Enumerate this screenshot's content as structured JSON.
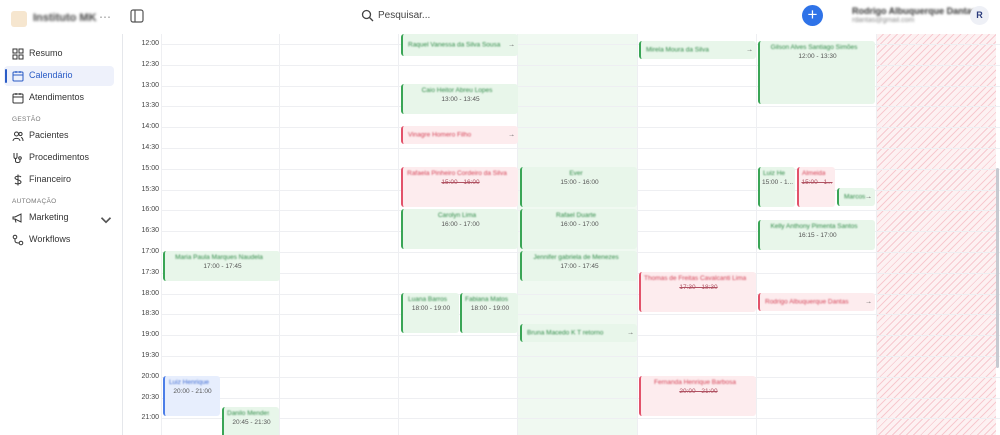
{
  "header": {
    "brand": "Instituto MK",
    "search_placeholder": "Pesquisar...",
    "add_label": "+",
    "user_name": "Rodrigo Albuquerque Dantas",
    "user_email": "rdantas@gmail.com",
    "avatar_initial": "R"
  },
  "sidebar": {
    "items": [
      {
        "label": "Resumo",
        "icon": "dashboard-icon"
      },
      {
        "label": "Calendário",
        "icon": "calendar-icon",
        "active": true
      },
      {
        "label": "Atendimentos",
        "icon": "calendar-list-icon"
      }
    ],
    "section_gestao": "GESTÃO",
    "gestao_items": [
      {
        "label": "Pacientes",
        "icon": "users-icon"
      },
      {
        "label": "Procedimentos",
        "icon": "stethoscope-icon"
      },
      {
        "label": "Financeiro",
        "icon": "dollar-icon"
      }
    ],
    "section_automacao": "AUTOMAÇÃO",
    "automacao_items": [
      {
        "label": "Marketing",
        "icon": "megaphone-icon"
      },
      {
        "label": "Workflows",
        "icon": "workflow-icon"
      }
    ]
  },
  "calendar": {
    "times": [
      "12:00",
      "12:30",
      "13:00",
      "13:30",
      "14:00",
      "14:30",
      "15:00",
      "15:30",
      "16:00",
      "16:30",
      "17:00",
      "17:30",
      "18:00",
      "18:30",
      "19:00",
      "19:30",
      "20:00",
      "20:30",
      "21:00"
    ],
    "events": [
      {
        "title": "Raquel Vanessa da Silva Sousa",
        "time": "",
        "color": "green",
        "arrow": true
      },
      {
        "title": "Mirela Moura da Silva",
        "time": "",
        "color": "green",
        "arrow": true
      },
      {
        "title": "Gilson Alves Santiago Simões",
        "time": "12:00 - 13:30",
        "color": "green"
      },
      {
        "title": "Caio Heitor Abreu Lopes",
        "time": "13:00 - 13:45",
        "color": "green"
      },
      {
        "title": "Vinagre Homero Filho",
        "time": "",
        "color": "red",
        "arrow": true
      },
      {
        "title": "Rafaela Pinheiro Cordeiro da Silva",
        "time": "15:00 - 16:00",
        "color": "red"
      },
      {
        "title": "Ever",
        "time": "15:00 - 16:00",
        "color": "green"
      },
      {
        "title": "Luiz Henrique",
        "time": "15:00 - 1...",
        "color": "green"
      },
      {
        "title": "Almeida",
        "time": "15:00 - 1...",
        "color": "red"
      },
      {
        "title": "Marcos",
        "time": "",
        "color": "green",
        "arrow": true
      },
      {
        "title": "Carolyn Lima",
        "time": "16:00 - 17:00",
        "color": "green"
      },
      {
        "title": "Rafael Duarte",
        "time": "16:00 - 17:00",
        "color": "green"
      },
      {
        "title": "Kelly Anthony Pimenta Santos",
        "time": "16:15 - 17:00",
        "color": "green"
      },
      {
        "title": "Maria Paula Marques Naudela",
        "time": "17:00 - 17:45",
        "color": "green"
      },
      {
        "title": "Jennifer gabriela de Menezes",
        "time": "17:00 - 17:45",
        "color": "green"
      },
      {
        "title": "Thomas de Freitas Cavalcanti Lima",
        "time": "17:30 - 18:30",
        "color": "red"
      },
      {
        "title": "Rodrigo Albuquerque Dantas",
        "time": "",
        "color": "red",
        "arrow": true
      },
      {
        "title": "Luana Barros",
        "time": "18:00 - 19:00",
        "color": "green"
      },
      {
        "title": "Fabiana Matos",
        "time": "18:00 - 19:00",
        "color": "green"
      },
      {
        "title": "Bruna Macedo K T retorno",
        "time": "",
        "color": "green",
        "arrow": true
      },
      {
        "title": "Luiz Henrique",
        "time": "20:00 - 21:00",
        "color": "blue"
      },
      {
        "title": "Fernanda Henrique Barbosa",
        "time": "20:00 - 21:00",
        "color": "red"
      },
      {
        "title": "Danilo Mendes",
        "time": "20:45 - 21:30",
        "color": "green"
      }
    ]
  }
}
